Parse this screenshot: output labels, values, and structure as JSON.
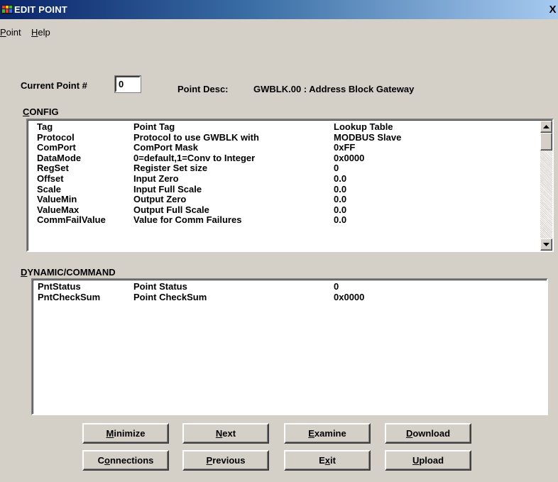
{
  "window": {
    "title": "EDIT POINT",
    "close_glyph": "X",
    "app_icon": "app-icon"
  },
  "menu": [
    {
      "hot": "P",
      "rest": "oint"
    },
    {
      "hot": "H",
      "rest": "elp"
    }
  ],
  "current_point": {
    "label": "Current Point #",
    "value": "0"
  },
  "point_desc": {
    "label": "Point Desc:",
    "value": "GWBLK.00 : Address Block Gateway"
  },
  "config": {
    "label_hot": "C",
    "label_rest": "ONFIG",
    "rows": [
      {
        "name": "Tag",
        "desc": "Point Tag",
        "value": "Lookup Table"
      },
      {
        "name": "Protocol",
        "desc": "Protocol to use GWBLK with",
        "value": "MODBUS Slave"
      },
      {
        "name": "ComPort",
        "desc": "ComPort Mask",
        "value": "0xFF"
      },
      {
        "name": "DataMode",
        "desc": "0=default,1=Conv to Integer",
        "value": "0x0000"
      },
      {
        "name": "RegSet",
        "desc": "Register Set size",
        "value": "0"
      },
      {
        "name": "Offset",
        "desc": "Input Zero",
        "value": "0.0"
      },
      {
        "name": "Scale",
        "desc": "Input Full Scale",
        "value": "0.0"
      },
      {
        "name": "ValueMin",
        "desc": "Output Zero",
        "value": "0.0"
      },
      {
        "name": "ValueMax",
        "desc": "Output Full Scale",
        "value": "0.0"
      },
      {
        "name": "CommFailValue",
        "desc": "Value for Comm Failures",
        "value": "0.0"
      }
    ]
  },
  "dynamic": {
    "label_hot": "D",
    "label_rest": "YNAMIC/COMMAND",
    "rows": [
      {
        "name": "PntStatus",
        "desc": "Point Status",
        "value": "0"
      },
      {
        "name": "PntCheckSum",
        "desc": "Point CheckSum",
        "value": "0x0000"
      }
    ]
  },
  "buttons": [
    {
      "id": "minimize",
      "pre": "",
      "hot": "M",
      "post": "inimize"
    },
    {
      "id": "next",
      "pre": "",
      "hot": "N",
      "post": "ext"
    },
    {
      "id": "examine",
      "pre": "",
      "hot": "E",
      "post": "xamine"
    },
    {
      "id": "download",
      "pre": "",
      "hot": "D",
      "post": "ownload"
    },
    {
      "id": "connections",
      "pre": "C",
      "hot": "o",
      "post": "nnections"
    },
    {
      "id": "previous",
      "pre": "",
      "hot": "P",
      "post": "revious"
    },
    {
      "id": "exit",
      "pre": "E",
      "hot": "x",
      "post": "it"
    },
    {
      "id": "upload",
      "pre": "",
      "hot": "U",
      "post": "pload"
    }
  ]
}
